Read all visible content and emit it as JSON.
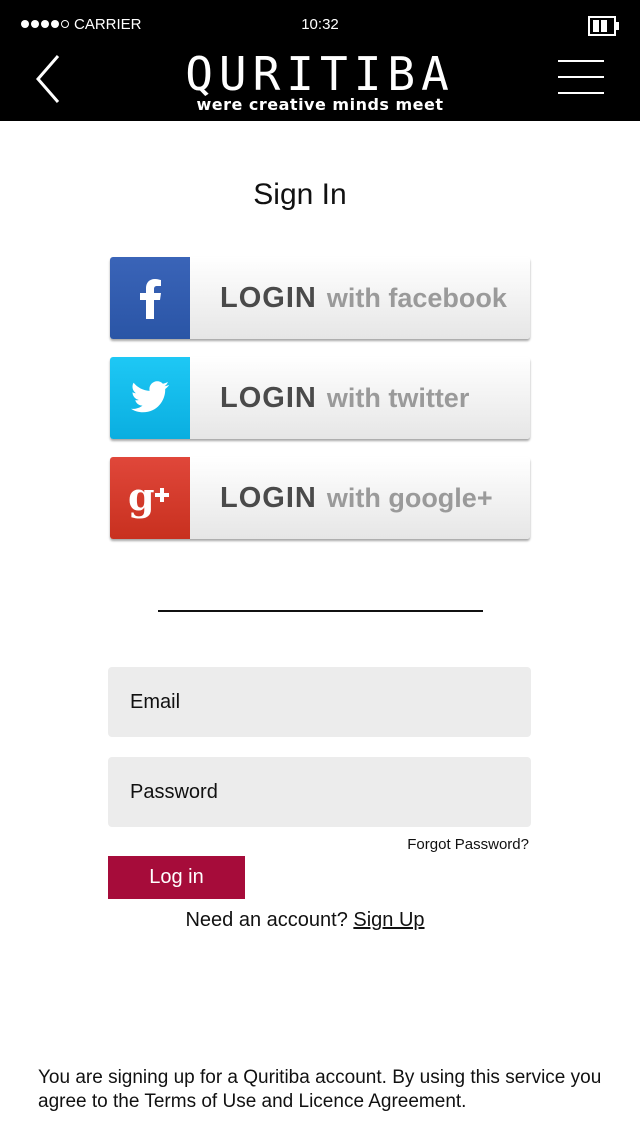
{
  "status_bar": {
    "carrier": "CARRIER",
    "time": "10:32"
  },
  "header": {
    "brand": "QURITIBA",
    "tagline": "were creative minds meet"
  },
  "page": {
    "title": "Sign In"
  },
  "social": [
    {
      "login": "LOGIN",
      "with": "with facebook",
      "color": "#3a5fb3"
    },
    {
      "login": "LOGIN",
      "with": "with twitter",
      "color": "#14b8ea"
    },
    {
      "login": "LOGIN",
      "with": "with google+",
      "color": "#d43b2b"
    }
  ],
  "form": {
    "email_placeholder": "Email",
    "password_placeholder": "Password",
    "forgot": "Forgot Password?",
    "login_button": "Log in",
    "need_account": "Need an account?",
    "signup": "Sign Up"
  },
  "legal": "You are signing up for a Quritiba account. By using this service you agree to the Terms of Use and Licence Agreement.",
  "colors": {
    "header_bg": "#000000",
    "accent": "#a60c3a",
    "field_bg": "#ececec"
  }
}
